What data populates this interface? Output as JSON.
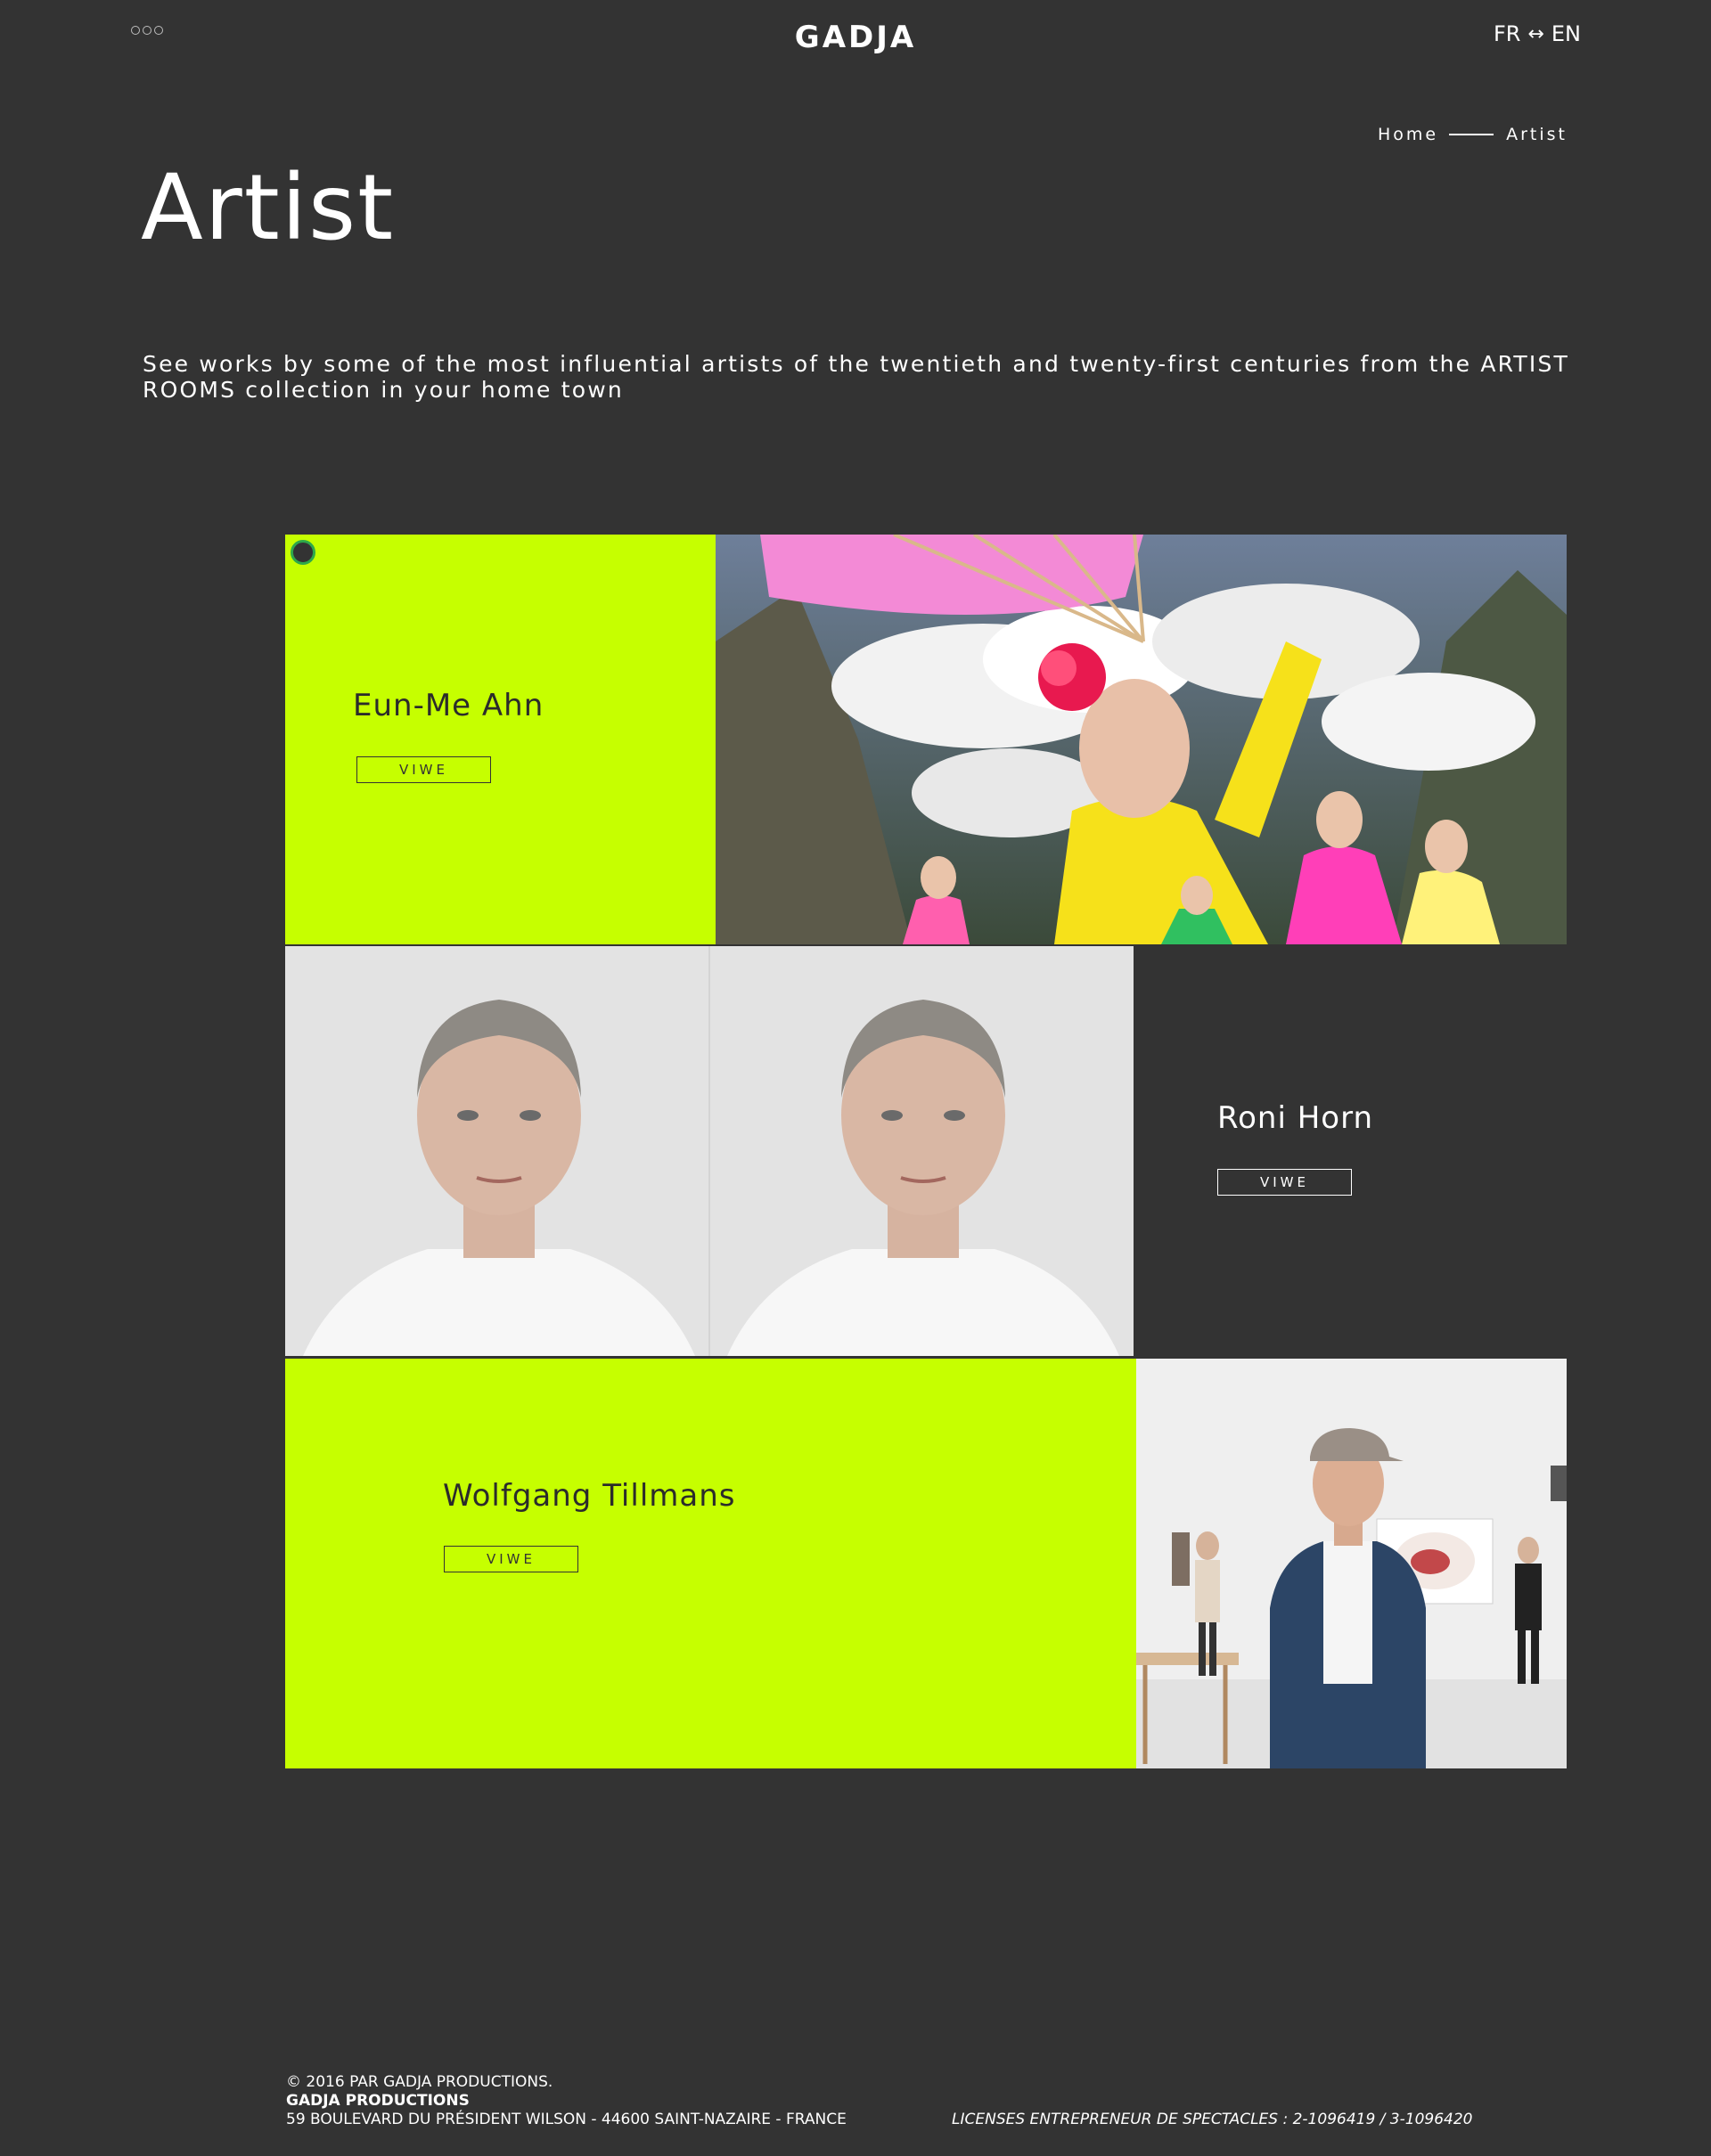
{
  "header": {
    "logo": "GADJA",
    "lang_from": "FR",
    "lang_arrow": "↔",
    "lang_to": "EN"
  },
  "breadcrumb": {
    "home": "Home",
    "current": "Artist"
  },
  "page": {
    "title": "Artist",
    "intro": "See works by some of the most influential artists of the twentieth and twenty-first centuries from the ARTIST ROOMS collection in your home town"
  },
  "artists": [
    {
      "name": "Eun-Me Ahn",
      "button": "VIWE"
    },
    {
      "name": "Roni Horn",
      "button": "VIWE"
    },
    {
      "name": "Wolfgang Tillmans",
      "button": "VIWE"
    }
  ],
  "footer": {
    "copyright": "© 2016 PAR GADJA PRODUCTIONS.",
    "company": "GADJA PRODUCTIONS",
    "address": "59 BOULEVARD DU PRÉSIDENT WILSON - 44600 SAINT-NAZAIRE - FRANCE",
    "licenses": "LICENSES ENTREPRENEUR DE SPECTACLES : 2-1096419 / 3-1096420"
  },
  "colors": {
    "background": "#333333",
    "accent": "#c6ff00"
  }
}
